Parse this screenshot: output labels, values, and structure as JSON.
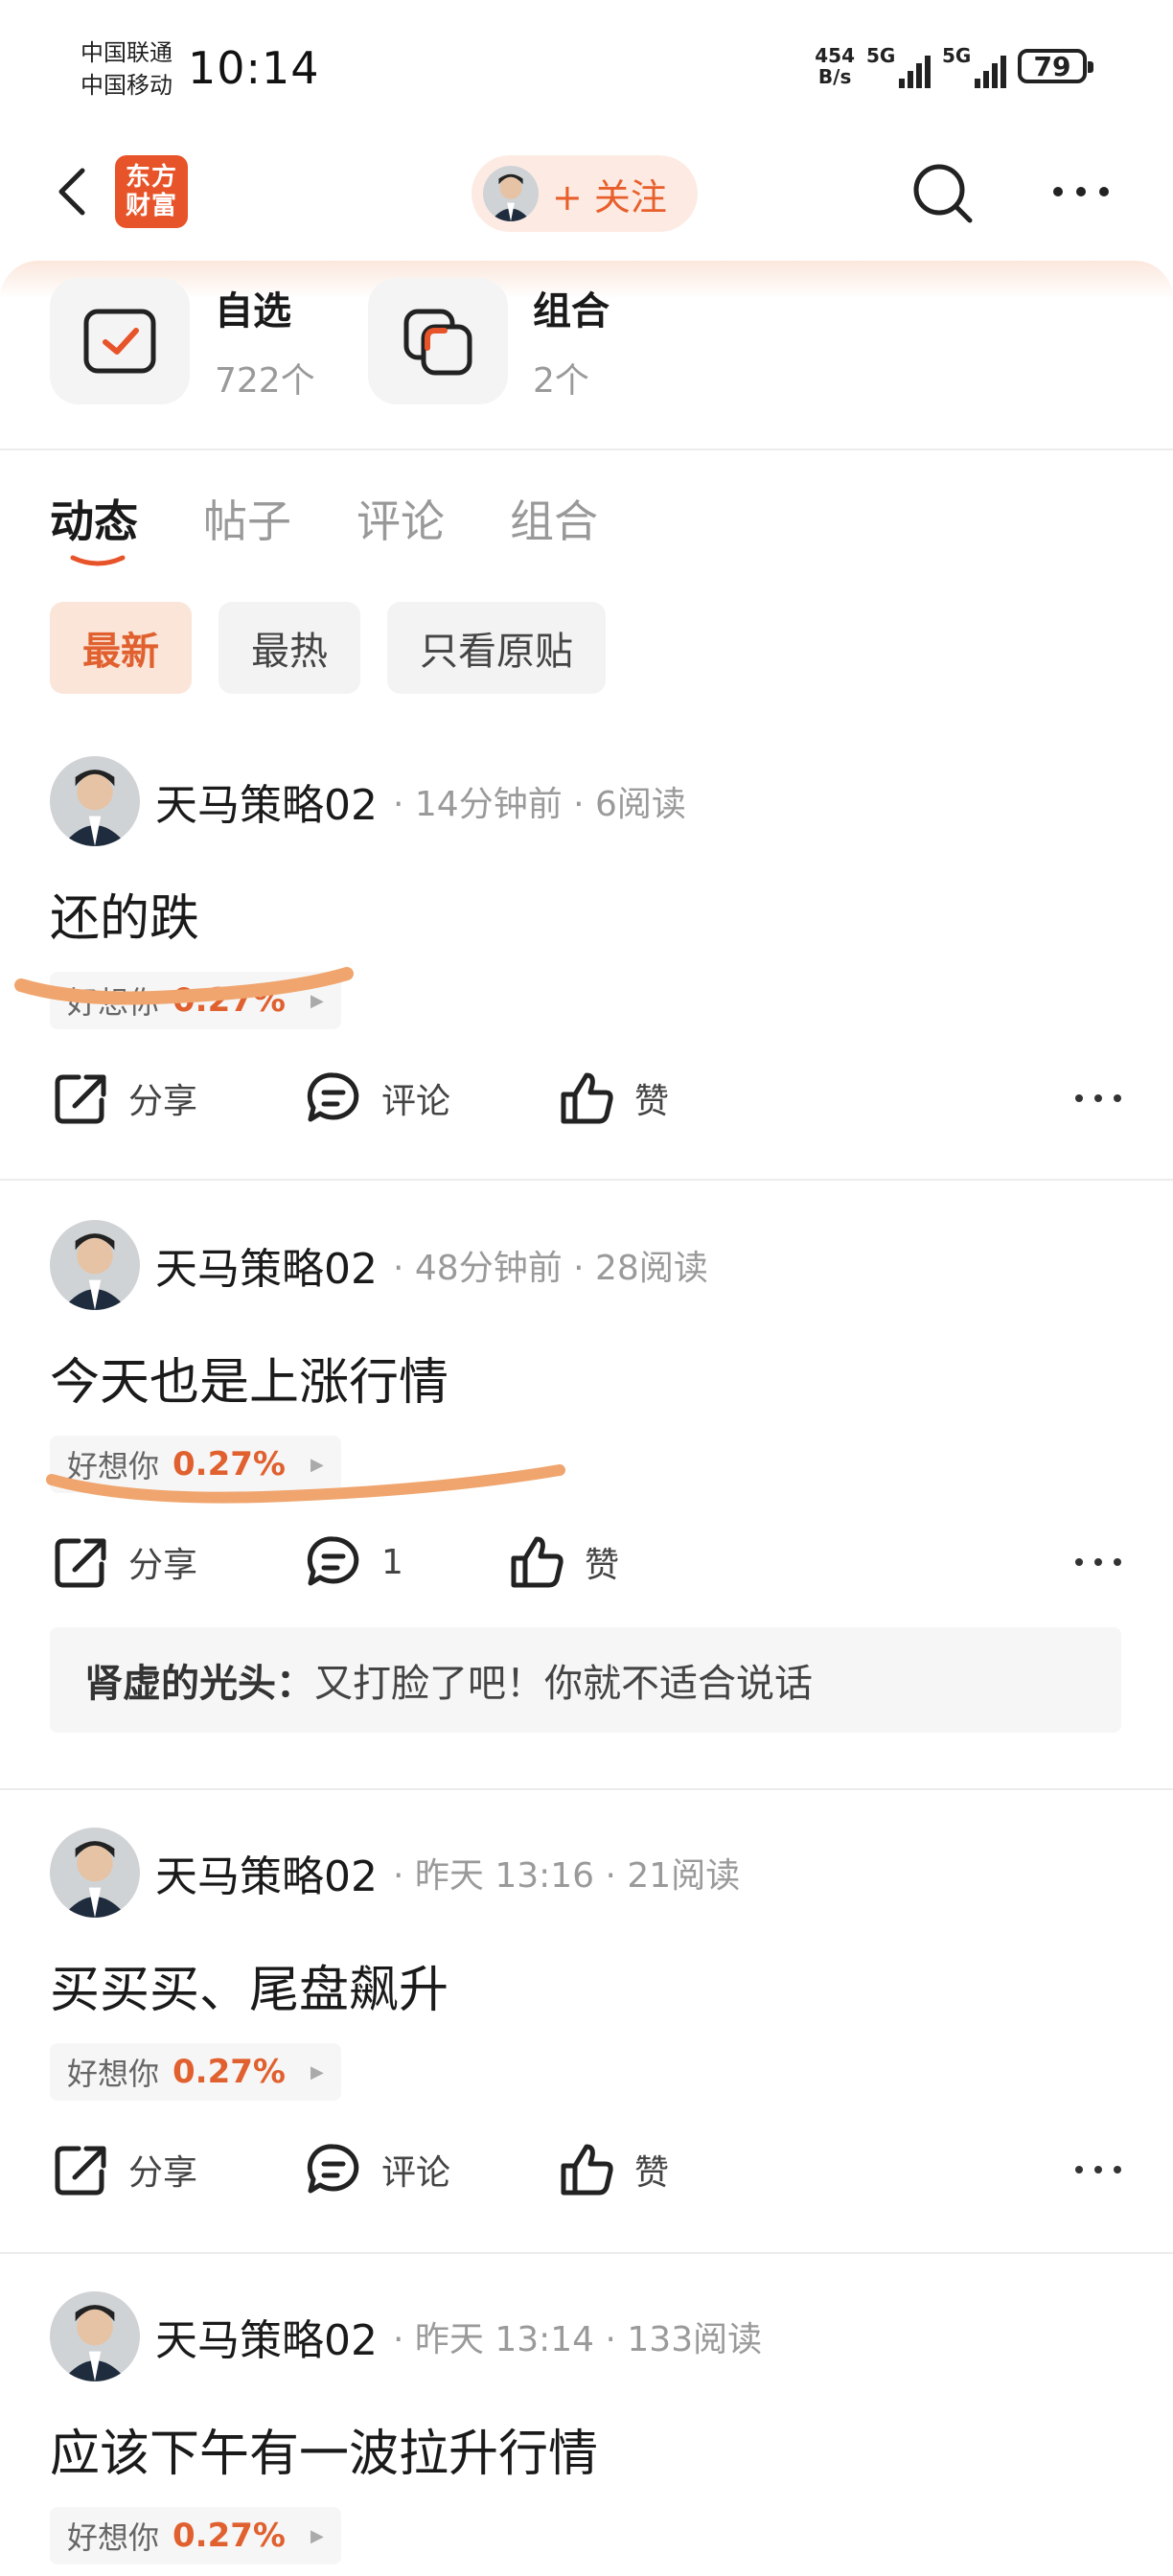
{
  "status_bar": {
    "carrier1": "中国联通",
    "carrier2": "中国移动",
    "time": "10:14",
    "net_speed_value": "454",
    "net_speed_unit": "B/s",
    "signal1_label": "5G",
    "signal2_label": "5G",
    "battery": "79"
  },
  "nav": {
    "logo_line1": "东方",
    "logo_line2": "财富",
    "follow_label": "+ 关注"
  },
  "collections": [
    {
      "title": "自选",
      "count": "722个"
    },
    {
      "title": "组合",
      "count": "2个"
    }
  ],
  "tabs": [
    "动态",
    "帖子",
    "评论",
    "组合"
  ],
  "active_tab": "动态",
  "filters": [
    "最新",
    "最热",
    "只看原贴"
  ],
  "active_filter": "最新",
  "posts": [
    {
      "author": "天马策略02",
      "meta": "· 14分钟前 · 6阅读",
      "text": "还的跌",
      "stock_name": "好想你",
      "stock_change": "0.27%",
      "share": "分享",
      "comment": "评论",
      "like": "赞"
    },
    {
      "author": "天马策略02",
      "meta": "· 48分钟前 · 28阅读",
      "text": "今天也是上涨行情",
      "stock_name": "好想你",
      "stock_change": "0.27%",
      "share": "分享",
      "comment": "1",
      "like": "赞",
      "reply_author": "肾虚的光头：",
      "reply_text": "又打脸了吧！你就不适合说话"
    },
    {
      "author": "天马策略02",
      "meta": "· 昨天 13:16 · 21阅读",
      "text": "买买买、尾盘飙升",
      "stock_name": "好想你",
      "stock_change": "0.27%",
      "share": "分享",
      "comment": "评论",
      "like": "赞"
    },
    {
      "author": "天马策略02",
      "meta": "· 昨天 13:14 · 133阅读",
      "text": "应该下午有一波拉升行情",
      "stock_name": "好想你",
      "stock_change": "0.27%"
    }
  ],
  "colors": {
    "accent": "#e0612f",
    "annotation": "#f0a56e"
  }
}
